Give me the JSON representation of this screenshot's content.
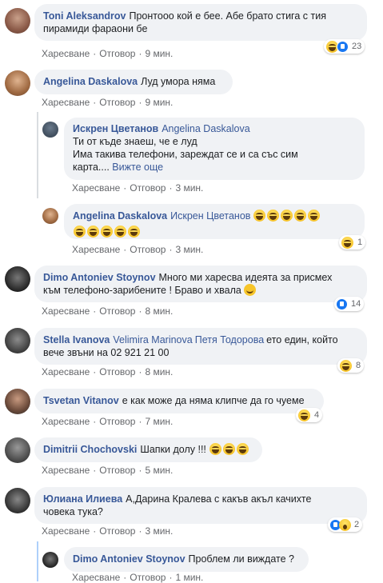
{
  "comments": [
    {
      "author": "Toni Aleksandrov",
      "text": "Пронтооо кой е бее. Абе брато стига с тия пирамиди фараони бе",
      "like": "Харесване",
      "reply": "Отговор",
      "time": "9 мин.",
      "reaction_count": "23"
    },
    {
      "author": "Angelina Daskalova",
      "text": "Луд умора няма",
      "like": "Харесване",
      "reply": "Отговор",
      "time": "9 мин."
    },
    {
      "author": "Искрен Цветанов",
      "tag": "Angelina Daskalova",
      "text1": "Ти от къде знаеш, че е луд",
      "text2": "Има такива телефони, зареждат се и са със сим",
      "text3": "карта....",
      "see_more": "Вижте още",
      "like": "Харесване",
      "reply": "Отговор",
      "time": "3 мин."
    },
    {
      "author": "Angelina Daskalova",
      "tag": "Искрен Цветанов",
      "like": "Харесване",
      "reply": "Отговор",
      "time": "3 мин.",
      "reaction_count": "1"
    },
    {
      "author": "Dimo Antoniev Stoynov",
      "text1": "Много ми харесва идеята за присмех",
      "text2": "към телефоно-зарибените ! Браво и хвала",
      "like": "Харесване",
      "reply": "Отговор",
      "time": "8 мин.",
      "reaction_count": "14"
    },
    {
      "author": "Stella Ivanova",
      "tag1": "Velimira Marinova",
      "tag2": "Петя Тодорова",
      "text1": "ето един, който",
      "text2": "вече звъни на 02 921 21 00",
      "like": "Харесване",
      "reply": "Отговор",
      "time": "8 мин.",
      "reaction_count": "8"
    },
    {
      "author": "Tsvetan Vitanov",
      "text": "е как може да няма клипче да го чуеме",
      "like": "Харесване",
      "reply": "Отговор",
      "time": "7 мин.",
      "reaction_count": "4"
    },
    {
      "author": "Dimitrii Chochovski",
      "text": "Шапки долу !!!",
      "like": "Харесване",
      "reply": "Отговор",
      "time": "5 мин."
    },
    {
      "author": "Юлиана Илиева",
      "text1": "А,Дарина Кралева с какъв акъл качихте",
      "text2": "човека тука?",
      "like": "Харесване",
      "reply": "Отговор",
      "time": "3 мин.",
      "reaction_count": "2"
    },
    {
      "author": "Dimo Antoniev Stoynov",
      "text": "Проблем ли виждате ?",
      "like": "Харесване",
      "reply": "Отговор",
      "time": "1 мин."
    }
  ],
  "separator": "·",
  "colors": {
    "link": "#385898",
    "bubble": "#f0f2f5",
    "muted": "#65676b"
  }
}
